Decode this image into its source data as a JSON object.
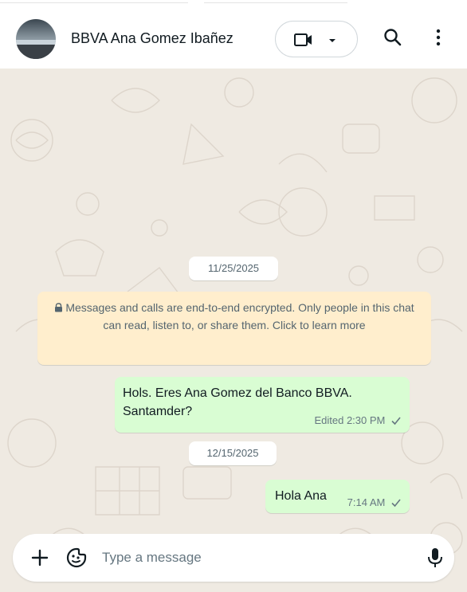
{
  "header": {
    "contact_name": "BBVA Ana Gomez Ibañez",
    "icons": [
      "avatar",
      "video-call-icon",
      "chevron-down-icon",
      "search-icon",
      "more-vert-icon"
    ]
  },
  "chat": {
    "date_1": "11/25/2025",
    "encryption_notice": "Messages and calls are end-to-end encrypted. Only people in this chat can read, listen to, or share them. Click to learn more",
    "messages": [
      {
        "text": "Hols. Eres Ana Gomez del Banco BBVA. Santamder?",
        "meta": "Edited 2:30 PM",
        "status": "sent"
      },
      {
        "text": "Hola Ana",
        "meta": "7:14 AM",
        "status": "sent"
      }
    ],
    "date_2": "12/15/2025",
    "colors": {
      "background": "#efeae2",
      "outgoing_bubble": "#d9fdd3",
      "notice": "#ffeecd"
    }
  },
  "composer": {
    "placeholder": "Type a message",
    "icons": [
      "plus-icon",
      "sticker-icon",
      "microphone-icon"
    ]
  }
}
